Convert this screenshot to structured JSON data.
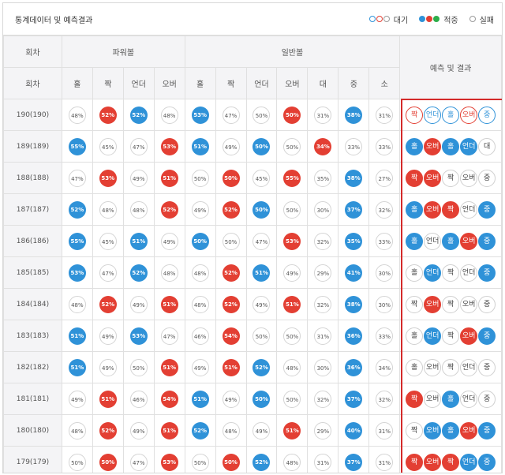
{
  "header": {
    "title": "통계데이터 및 예측결과",
    "legend": [
      {
        "label": "대기",
        "dots": [
          "o-b",
          "o-r",
          "o-g"
        ]
      },
      {
        "label": "적중",
        "dots": [
          "f-b",
          "f-r",
          "f-g"
        ]
      },
      {
        "label": "실패",
        "dots": [
          "o-g"
        ]
      }
    ]
  },
  "table": {
    "col_round": "회차",
    "group_power": "파워볼",
    "group_normal": "일반볼",
    "col_result": "예측 및 결과",
    "power_headers": [
      "홀",
      "짝",
      "언더",
      "오버"
    ],
    "normal_headers": [
      "홀",
      "짝",
      "언더",
      "오버",
      "대",
      "중",
      "소"
    ],
    "round_header": "회차",
    "colors": {
      "blue": "#2f92d8",
      "red": "#e33f33",
      "green": "#2dae4a",
      "frame": "#d42a2a"
    },
    "rows": [
      {
        "round": "190(190)",
        "power": [
          [
            "48%",
            "n"
          ],
          [
            "52%",
            "r"
          ],
          [
            "52%",
            "b"
          ],
          [
            "48%",
            "n"
          ]
        ],
        "normal": [
          [
            "53%",
            "b"
          ],
          [
            "47%",
            "n"
          ],
          [
            "50%",
            "n"
          ],
          [
            "50%",
            "r"
          ],
          [
            "31%",
            "n"
          ],
          [
            "38%",
            "b"
          ],
          [
            "31%",
            "n"
          ]
        ],
        "results": [
          [
            "짝",
            "or"
          ],
          [
            "언더",
            "ob"
          ],
          [
            "홀",
            "ob"
          ],
          [
            "오버",
            "or"
          ],
          [
            "중",
            "ob"
          ]
        ]
      },
      {
        "round": "189(189)",
        "power": [
          [
            "55%",
            "b"
          ],
          [
            "45%",
            "n"
          ],
          [
            "47%",
            "n"
          ],
          [
            "53%",
            "r"
          ]
        ],
        "normal": [
          [
            "51%",
            "b"
          ],
          [
            "49%",
            "n"
          ],
          [
            "50%",
            "b"
          ],
          [
            "50%",
            "n"
          ],
          [
            "34%",
            "r"
          ],
          [
            "33%",
            "n"
          ],
          [
            "33%",
            "n"
          ]
        ],
        "results": [
          [
            "홀",
            "b"
          ],
          [
            "오버",
            "r"
          ],
          [
            "홀",
            "b"
          ],
          [
            "언더",
            "b"
          ],
          [
            "대",
            "n"
          ]
        ]
      },
      {
        "round": "188(188)",
        "power": [
          [
            "47%",
            "n"
          ],
          [
            "53%",
            "r"
          ],
          [
            "49%",
            "n"
          ],
          [
            "51%",
            "r"
          ]
        ],
        "normal": [
          [
            "50%",
            "n"
          ],
          [
            "50%",
            "r"
          ],
          [
            "45%",
            "n"
          ],
          [
            "55%",
            "r"
          ],
          [
            "35%",
            "n"
          ],
          [
            "38%",
            "b"
          ],
          [
            "27%",
            "n"
          ]
        ],
        "results": [
          [
            "짝",
            "r"
          ],
          [
            "오버",
            "r"
          ],
          [
            "짝",
            "n"
          ],
          [
            "오버",
            "n"
          ],
          [
            "중",
            "n"
          ]
        ]
      },
      {
        "round": "187(187)",
        "power": [
          [
            "52%",
            "b"
          ],
          [
            "48%",
            "n"
          ],
          [
            "48%",
            "n"
          ],
          [
            "52%",
            "r"
          ]
        ],
        "normal": [
          [
            "49%",
            "n"
          ],
          [
            "52%",
            "r"
          ],
          [
            "50%",
            "b"
          ],
          [
            "50%",
            "n"
          ],
          [
            "30%",
            "n"
          ],
          [
            "37%",
            "b"
          ],
          [
            "32%",
            "n"
          ]
        ],
        "results": [
          [
            "홀",
            "b"
          ],
          [
            "오버",
            "r"
          ],
          [
            "짝",
            "r"
          ],
          [
            "언더",
            "n"
          ],
          [
            "중",
            "b"
          ]
        ]
      },
      {
        "round": "186(186)",
        "power": [
          [
            "55%",
            "b"
          ],
          [
            "45%",
            "n"
          ],
          [
            "51%",
            "b"
          ],
          [
            "49%",
            "n"
          ]
        ],
        "normal": [
          [
            "50%",
            "b"
          ],
          [
            "50%",
            "n"
          ],
          [
            "47%",
            "n"
          ],
          [
            "53%",
            "r"
          ],
          [
            "32%",
            "n"
          ],
          [
            "35%",
            "b"
          ],
          [
            "33%",
            "n"
          ]
        ],
        "results": [
          [
            "홀",
            "b"
          ],
          [
            "언더",
            "n"
          ],
          [
            "홀",
            "b"
          ],
          [
            "오버",
            "r"
          ],
          [
            "중",
            "b"
          ]
        ]
      },
      {
        "round": "185(185)",
        "power": [
          [
            "53%",
            "b"
          ],
          [
            "47%",
            "n"
          ],
          [
            "52%",
            "b"
          ],
          [
            "48%",
            "n"
          ]
        ],
        "normal": [
          [
            "48%",
            "n"
          ],
          [
            "52%",
            "r"
          ],
          [
            "51%",
            "b"
          ],
          [
            "49%",
            "n"
          ],
          [
            "29%",
            "n"
          ],
          [
            "41%",
            "b"
          ],
          [
            "30%",
            "n"
          ]
        ],
        "results": [
          [
            "홀",
            "n"
          ],
          [
            "언더",
            "b"
          ],
          [
            "짝",
            "n"
          ],
          [
            "언더",
            "n"
          ],
          [
            "중",
            "b"
          ]
        ]
      },
      {
        "round": "184(184)",
        "power": [
          [
            "48%",
            "n"
          ],
          [
            "52%",
            "r"
          ],
          [
            "49%",
            "n"
          ],
          [
            "51%",
            "r"
          ]
        ],
        "normal": [
          [
            "48%",
            "n"
          ],
          [
            "52%",
            "r"
          ],
          [
            "49%",
            "n"
          ],
          [
            "51%",
            "r"
          ],
          [
            "32%",
            "n"
          ],
          [
            "38%",
            "b"
          ],
          [
            "30%",
            "n"
          ]
        ],
        "results": [
          [
            "짝",
            "n"
          ],
          [
            "오버",
            "r"
          ],
          [
            "짝",
            "n"
          ],
          [
            "오버",
            "n"
          ],
          [
            "중",
            "n"
          ]
        ]
      },
      {
        "round": "183(183)",
        "power": [
          [
            "51%",
            "b"
          ],
          [
            "49%",
            "n"
          ],
          [
            "53%",
            "b"
          ],
          [
            "47%",
            "n"
          ]
        ],
        "normal": [
          [
            "46%",
            "n"
          ],
          [
            "54%",
            "r"
          ],
          [
            "50%",
            "n"
          ],
          [
            "50%",
            "n"
          ],
          [
            "31%",
            "n"
          ],
          [
            "36%",
            "b"
          ],
          [
            "33%",
            "n"
          ]
        ],
        "results": [
          [
            "홀",
            "n"
          ],
          [
            "언더",
            "b"
          ],
          [
            "짝",
            "n"
          ],
          [
            "오버",
            "r"
          ],
          [
            "중",
            "b"
          ]
        ]
      },
      {
        "round": "182(182)",
        "power": [
          [
            "51%",
            "b"
          ],
          [
            "49%",
            "n"
          ],
          [
            "50%",
            "n"
          ],
          [
            "51%",
            "r"
          ]
        ],
        "normal": [
          [
            "49%",
            "n"
          ],
          [
            "51%",
            "r"
          ],
          [
            "52%",
            "b"
          ],
          [
            "48%",
            "n"
          ],
          [
            "30%",
            "n"
          ],
          [
            "36%",
            "b"
          ],
          [
            "34%",
            "n"
          ]
        ],
        "results": [
          [
            "홀",
            "n"
          ],
          [
            "오버",
            "n"
          ],
          [
            "짝",
            "n"
          ],
          [
            "언더",
            "n"
          ],
          [
            "중",
            "n"
          ]
        ]
      },
      {
        "round": "181(181)",
        "power": [
          [
            "49%",
            "n"
          ],
          [
            "51%",
            "r"
          ],
          [
            "46%",
            "n"
          ],
          [
            "54%",
            "r"
          ]
        ],
        "normal": [
          [
            "51%",
            "b"
          ],
          [
            "49%",
            "n"
          ],
          [
            "50%",
            "b"
          ],
          [
            "50%",
            "n"
          ],
          [
            "32%",
            "n"
          ],
          [
            "37%",
            "b"
          ],
          [
            "32%",
            "n"
          ]
        ],
        "results": [
          [
            "짝",
            "r"
          ],
          [
            "오버",
            "n"
          ],
          [
            "홀",
            "b"
          ],
          [
            "언더",
            "n"
          ],
          [
            "중",
            "n"
          ]
        ]
      },
      {
        "round": "180(180)",
        "power": [
          [
            "48%",
            "n"
          ],
          [
            "52%",
            "r"
          ],
          [
            "49%",
            "n"
          ],
          [
            "51%",
            "r"
          ]
        ],
        "normal": [
          [
            "52%",
            "b"
          ],
          [
            "48%",
            "n"
          ],
          [
            "49%",
            "n"
          ],
          [
            "51%",
            "r"
          ],
          [
            "29%",
            "n"
          ],
          [
            "40%",
            "b"
          ],
          [
            "31%",
            "n"
          ]
        ],
        "results": [
          [
            "짝",
            "n"
          ],
          [
            "오버",
            "b"
          ],
          [
            "홀",
            "b"
          ],
          [
            "오버",
            "r"
          ],
          [
            "중",
            "b"
          ]
        ]
      },
      {
        "round": "179(179)",
        "power": [
          [
            "50%",
            "n"
          ],
          [
            "50%",
            "r"
          ],
          [
            "47%",
            "n"
          ],
          [
            "53%",
            "r"
          ]
        ],
        "normal": [
          [
            "50%",
            "n"
          ],
          [
            "50%",
            "r"
          ],
          [
            "52%",
            "b"
          ],
          [
            "48%",
            "n"
          ],
          [
            "31%",
            "n"
          ],
          [
            "37%",
            "b"
          ],
          [
            "31%",
            "n"
          ]
        ],
        "results": [
          [
            "짝",
            "r"
          ],
          [
            "오버",
            "r"
          ],
          [
            "짝",
            "r"
          ],
          [
            "언더",
            "b"
          ],
          [
            "중",
            "b"
          ]
        ]
      }
    ]
  }
}
